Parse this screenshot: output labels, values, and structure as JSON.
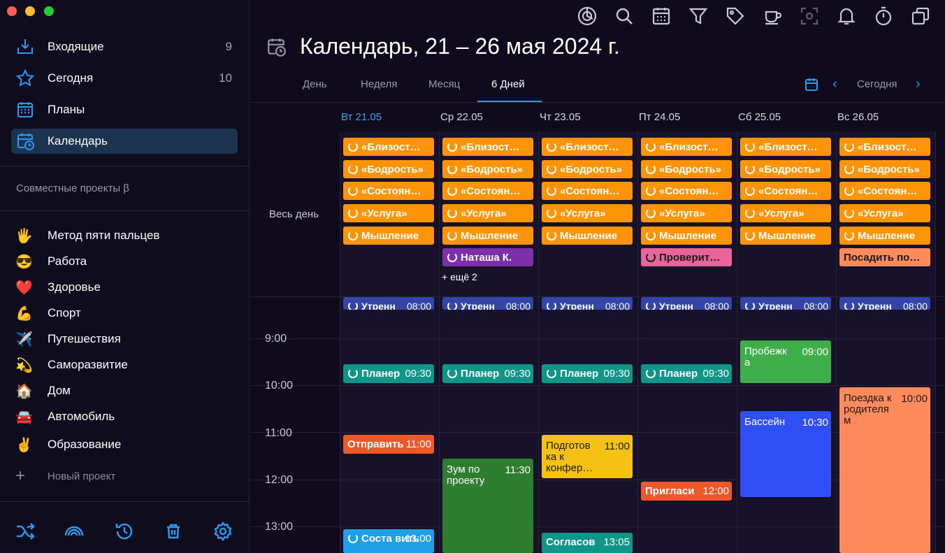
{
  "sidebar": {
    "nav": [
      {
        "label": "Входящие",
        "count": "9",
        "icon": "inbox-icon"
      },
      {
        "label": "Сегодня",
        "count": "10",
        "icon": "star-icon"
      },
      {
        "label": "Планы",
        "count": "",
        "icon": "calendar-grid-icon"
      },
      {
        "label": "Календарь",
        "count": "",
        "icon": "calendar-clock-icon",
        "selected": true
      }
    ],
    "shared_label": "Совместные проекты β",
    "projects": [
      {
        "emoji": "🖐",
        "label": "Метод пяти пальцев"
      },
      {
        "emoji": "😎",
        "label": "Работа"
      },
      {
        "emoji": "❤️",
        "label": "Здоровье"
      },
      {
        "emoji": "💪",
        "label": "Спорт"
      },
      {
        "emoji": "✈️",
        "label": "Путешествия"
      },
      {
        "emoji": "💫",
        "label": "Саморазвитие"
      },
      {
        "emoji": "🏠",
        "label": "Дом"
      },
      {
        "emoji": "🚘",
        "label": "Автомобиль"
      },
      {
        "emoji": "✌️",
        "label": "Образование"
      }
    ],
    "new_project": "Новый проект",
    "bottom_icons": [
      "shuffle-icon",
      "signal-icon",
      "history-icon",
      "trash-icon",
      "settings-icon"
    ]
  },
  "toolbar": {
    "icons": [
      "focus-icon",
      "search-icon",
      "calendar-icon",
      "filter-icon",
      "tag-icon",
      "cup-icon",
      "scan-icon",
      "bell-icon",
      "timer-icon",
      "windows-icon"
    ]
  },
  "header": {
    "title": "Календарь, 21 – 26 мая 2024 г.",
    "tabs": [
      "День",
      "Неделя",
      "Месяц",
      "6 Дней"
    ],
    "active_tab": "6 Дней",
    "today_label": "Сегодня"
  },
  "days": [
    "Вт 21.05",
    "Ср 22.05",
    "Чт 23.05",
    "Пт 24.05",
    "Сб 25.05",
    "Вс 26.05"
  ],
  "allday_label": "Весь день",
  "hours": [
    "9:00",
    "10:00",
    "11:00",
    "12:00",
    "13:00"
  ],
  "allday_events": [
    "«Близост…",
    "«Бодрость»",
    "«Состоян…",
    "«Услуга»",
    "Мышление"
  ],
  "extra_allday": [
    {
      "day": 1,
      "text": "Наташа К.",
      "color": "#7b2fa8",
      "recurring": true
    },
    {
      "day": 1,
      "more": "+ ещё 2"
    },
    {
      "day": 3,
      "text": "Проверит…",
      "color": "#e8659a",
      "recurring": true,
      "dark": true
    },
    {
      "day": 5,
      "text": "Посадить по…",
      "color": "#ff8a5c",
      "recurring": false,
      "dark": true
    }
  ],
  "morning_event": {
    "text": "Утренн",
    "time": "08:00"
  },
  "timed_events": [
    {
      "day": 0,
      "text": "Планер",
      "time": "09:30",
      "color": "#0f9688",
      "recurring": true
    },
    {
      "day": 1,
      "text": "Планер",
      "time": "09:30",
      "color": "#0f9688",
      "recurring": true
    },
    {
      "day": 2,
      "text": "Планер",
      "time": "09:30",
      "color": "#0f9688",
      "recurring": true
    },
    {
      "day": 3,
      "text": "Планер",
      "time": "09:30",
      "color": "#0f9688",
      "recurring": true
    },
    {
      "day": 4,
      "text": "Пробежк а",
      "time": "09:00",
      "color": "#3fae4a"
    },
    {
      "day": 5,
      "text": "Поездка к родителя м",
      "time": "10:00",
      "color": "#ff8a5c",
      "dark": true
    },
    {
      "day": 4,
      "text": "Бассейн",
      "time": "10:30",
      "color": "#2f4ff5"
    },
    {
      "day": 0,
      "text": "Отправить",
      "time": "11:00",
      "color": "#f0582a"
    },
    {
      "day": 2,
      "text": "Подготов ка к конфер…",
      "time": "11:00",
      "color": "#f5c113",
      "dark": true
    },
    {
      "day": 1,
      "text": "Зум по проекту",
      "time": "11:30",
      "color": "#2f7d2f"
    },
    {
      "day": 3,
      "text": "Пригласи",
      "time": "12:00",
      "color": "#f0582a"
    },
    {
      "day": 0,
      "text": "Соста вить",
      "time": "13:00",
      "color": "#1e9fe8",
      "recurring": true
    },
    {
      "day": 2,
      "text": "Согласов",
      "time": "13:05",
      "color": "#0f9688"
    }
  ]
}
